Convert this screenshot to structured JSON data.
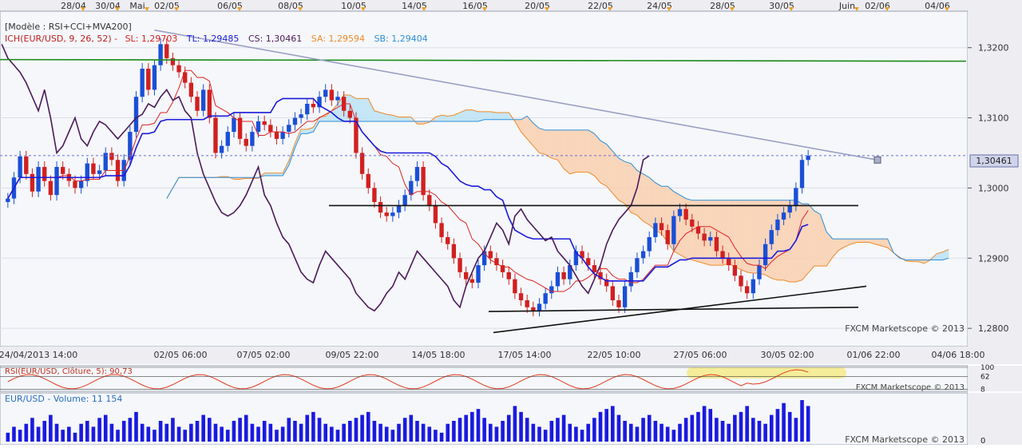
{
  "chart_data": [
    {
      "type": "candlestick",
      "pair": "EUR/USD",
      "template_label": "[Modèle : RSI+CCI+MVA200]",
      "indicator_label": "ICH(EUR/USD, 9, 26, 52) -",
      "legend": [
        {
          "key": "SL",
          "label": "SL: 1,29703",
          "value": 1.29703,
          "color": "#dd2222"
        },
        {
          "key": "TL",
          "label": "TL: 1,29485",
          "value": 1.29485,
          "color": "#1a1adb"
        },
        {
          "key": "CS",
          "label": "CS: 1,30461",
          "value": 1.30461,
          "color": "#4b1a5a"
        },
        {
          "key": "SA",
          "label": "SA: 1,29594",
          "value": 1.29594,
          "color": "#f08a2a"
        },
        {
          "key": "SB",
          "label": "SB: 1,29404",
          "value": 1.29404,
          "color": "#2f8fd8"
        }
      ],
      "top_dates": [
        "28/04",
        "30/04",
        "Mai",
        "02/05",
        "06/05",
        "08/05",
        "10/05",
        "14/05",
        "16/05",
        "20/05",
        "22/05",
        "24/05",
        "28/05",
        "30/05",
        "Juin",
        "02/06",
        "04/06"
      ],
      "bottom_dates": [
        "24/04/2013 14:00",
        "02/05 06:00",
        "07/05 02:00",
        "09/05 22:00",
        "14/05 18:00",
        "17/05 14:00",
        "22/05 10:00",
        "27/05 06:00",
        "30/05 02:00",
        "01/06 22:00",
        "04/06 18:00"
      ],
      "y_ticks": [
        {
          "label": "1,3200",
          "value": 1.32
        },
        {
          "label": "1,3100",
          "value": 1.31
        },
        {
          "label": "1,3000",
          "value": 1.3
        },
        {
          "label": "1,2900",
          "value": 1.29
        },
        {
          "label": "1,2800",
          "value": 1.28
        }
      ],
      "ylim": [
        1.2774,
        1.3252
      ],
      "current_price": {
        "label": "1,30461",
        "value": 1.30461
      },
      "mva200": 1.3183,
      "watermark": "FXCM Marketscope © 2013",
      "closes": [
        1.2985,
        1.3015,
        1.3045,
        1.302,
        1.2995,
        1.303,
        1.301,
        1.299,
        1.303,
        1.302,
        1.301,
        1.3,
        1.301,
        1.3035,
        1.302,
        1.3025,
        1.305,
        1.304,
        1.301,
        1.304,
        1.308,
        1.313,
        1.317,
        1.314,
        1.3175,
        1.3205,
        1.3185,
        1.3175,
        1.3165,
        1.315,
        1.313,
        1.311,
        1.314,
        1.31,
        1.305,
        1.306,
        1.308,
        1.31,
        1.307,
        1.306,
        1.308,
        1.3095,
        1.309,
        1.308,
        1.307,
        1.308,
        1.309,
        1.31,
        1.3105,
        1.312,
        1.3115,
        1.313,
        1.314,
        1.3125,
        1.313,
        1.311,
        1.31,
        1.305,
        1.302,
        1.3,
        1.298,
        1.2965,
        1.296,
        1.2965,
        1.2975,
        1.299,
        1.301,
        1.303,
        1.299,
        1.2975,
        1.295,
        1.293,
        1.292,
        1.29,
        1.288,
        1.287,
        1.2865,
        1.289,
        1.291,
        1.29,
        1.289,
        1.288,
        1.287,
        1.285,
        1.284,
        1.283,
        1.2825,
        1.2835,
        1.285,
        1.286,
        1.288,
        1.287,
        1.289,
        1.291,
        1.29,
        1.289,
        1.288,
        1.287,
        1.286,
        1.284,
        1.283,
        1.286,
        1.288,
        1.29,
        1.291,
        1.293,
        1.295,
        1.294,
        1.292,
        1.296,
        1.297,
        1.2955,
        1.2945,
        1.2935,
        1.2925,
        1.293,
        1.291,
        1.29,
        1.289,
        1.2875,
        1.286,
        1.285,
        1.287,
        1.289,
        1.292,
        1.294,
        1.2955,
        1.2965,
        1.2975,
        1.3,
        1.304,
        1.30461
      ],
      "volume_label": "EUR/USD - Volume: 11 154",
      "volume_ticks": [
        {
          "label": "0",
          "value": 0
        }
      ],
      "volumes": [
        3,
        5,
        4,
        6,
        8,
        5,
        7,
        9,
        6,
        4,
        5,
        3,
        6,
        7,
        5,
        8,
        9,
        6,
        4,
        7,
        8,
        10,
        6,
        5,
        4,
        7,
        6,
        8,
        5,
        4,
        6,
        7,
        9,
        8,
        6,
        5,
        4,
        7,
        8,
        9,
        6,
        5,
        7,
        6,
        4,
        5,
        8,
        7,
        6,
        9,
        10,
        8,
        6,
        5,
        4,
        6,
        7,
        8,
        9,
        10,
        7,
        6,
        5,
        4,
        6,
        8,
        9,
        7,
        6,
        5,
        4,
        3,
        6,
        7,
        8,
        9,
        10,
        11,
        8,
        6,
        5,
        7,
        9,
        12,
        10,
        8,
        6,
        5,
        4,
        7,
        8,
        9,
        6,
        5,
        4,
        6,
        8,
        10,
        11,
        12,
        9,
        7,
        6,
        5,
        8,
        9,
        7,
        6,
        5,
        4,
        6,
        8,
        9,
        10,
        12,
        11,
        8,
        7,
        6,
        9,
        10,
        12,
        8,
        7,
        6,
        9,
        11,
        13,
        10,
        8,
        14,
        12
      ]
    },
    {
      "type": "line",
      "name": "RSI(EUR/USD, Clôture, 5): 90,73",
      "y_ticks": [
        {
          "label": "100",
          "value": 100
        },
        {
          "label": "62",
          "value": 62
        },
        {
          "label": "8",
          "value": 8
        }
      ]
    }
  ],
  "colors": {
    "background": "#ffffff",
    "panel_bg": "#f5f7fa",
    "axis_bg": "#ededf2",
    "bull": "#1a4fd6",
    "bear": "#d12020",
    "mva200": "#1a8a1a",
    "kumo_bull": "#bfe3f5",
    "kumo_bear": "#f9d0b3",
    "trendline": "#9aa0c4",
    "rsi": "#e23b1f",
    "volume": "#1a1ae0",
    "price_tag_bg": "#d0d4ea"
  }
}
